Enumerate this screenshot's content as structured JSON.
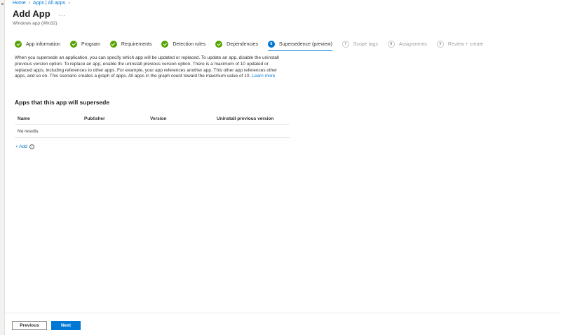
{
  "breadcrumb": {
    "home": "Home",
    "apps": "Apps | All apps"
  },
  "header": {
    "title": "Add App",
    "more": "...",
    "subtitle": "Windows app (Win32)"
  },
  "wizard": {
    "steps": [
      {
        "label": "App information",
        "state": "done"
      },
      {
        "label": "Program",
        "state": "done"
      },
      {
        "label": "Requirements",
        "state": "done"
      },
      {
        "label": "Detection rules",
        "state": "done"
      },
      {
        "label": "Dependencies",
        "state": "done"
      },
      {
        "number": "6",
        "label": "Supersedence (preview)",
        "state": "current"
      },
      {
        "number": "7",
        "label": "Scope tags",
        "state": "future"
      },
      {
        "number": "8",
        "label": "Assignments",
        "state": "future"
      },
      {
        "number": "9",
        "label": "Review + create",
        "state": "future"
      }
    ]
  },
  "main": {
    "description": "When you supersede an application, you can specify which app will be updated or replaced. To update an app, disable the uninstall previous version option. To replace an app, enable the uninstall previous version option. There is a maximum of 10 updated or replaced apps, including references to other apps. For example, your app references another app. This other app references other apps, and so on. This scenario creates a graph of apps. All apps in the graph count toward the maximum value of 10.",
    "learn_more": "Learn more",
    "section_title": "Apps that this app will supersede",
    "table": {
      "columns": [
        "Name",
        "Publisher",
        "Version",
        "Uninstall previous version"
      ],
      "empty_text": "No results."
    },
    "add_label": "+ Add",
    "info_glyph": "i"
  },
  "footer": {
    "previous_label": "Previous",
    "next_label": "Next"
  },
  "colors": {
    "accent": "#0078d4",
    "done": "#57a300",
    "muted": "#a19f9d"
  }
}
